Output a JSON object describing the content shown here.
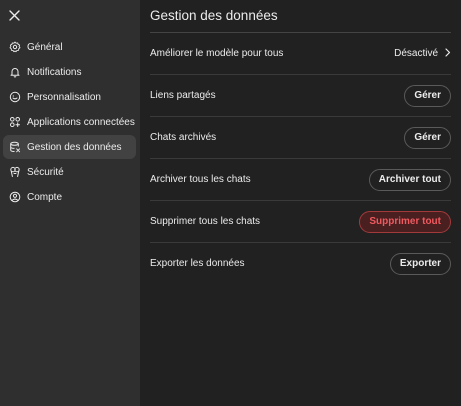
{
  "sidebar": {
    "items": [
      {
        "label": "Général",
        "icon": "gear-icon",
        "active": false
      },
      {
        "label": "Notifications",
        "icon": "bell-icon",
        "active": false
      },
      {
        "label": "Personnalisation",
        "icon": "personalization-icon",
        "active": false
      },
      {
        "label": "Applications connectées",
        "icon": "apps-grid-icon",
        "active": false
      },
      {
        "label": "Gestion des données",
        "icon": "database-icon",
        "active": true
      },
      {
        "label": "Sécurité",
        "icon": "security-icon",
        "active": false
      },
      {
        "label": "Compte",
        "icon": "user-circle-icon",
        "active": false
      }
    ]
  },
  "main": {
    "title": "Gestion des données",
    "rows": [
      {
        "label": "Améliorer le modèle pour tous",
        "control": "select",
        "value": "Désactivé"
      },
      {
        "label": "Liens partagés",
        "control": "button",
        "value": "Gérer"
      },
      {
        "label": "Chats archivés",
        "control": "button",
        "value": "Gérer"
      },
      {
        "label": "Archiver tous les chats",
        "control": "button",
        "value": "Archiver tout"
      },
      {
        "label": "Supprimer tous les chats",
        "control": "danger-button",
        "value": "Supprimer tout"
      },
      {
        "label": "Exporter les données",
        "control": "button",
        "value": "Exporter"
      }
    ]
  },
  "colors": {
    "sidebar_bg": "#2f2f2f",
    "main_bg": "#212121",
    "active_item_bg": "#424242",
    "danger_text": "#ee5a5f",
    "danger_border": "#a23a3c"
  }
}
